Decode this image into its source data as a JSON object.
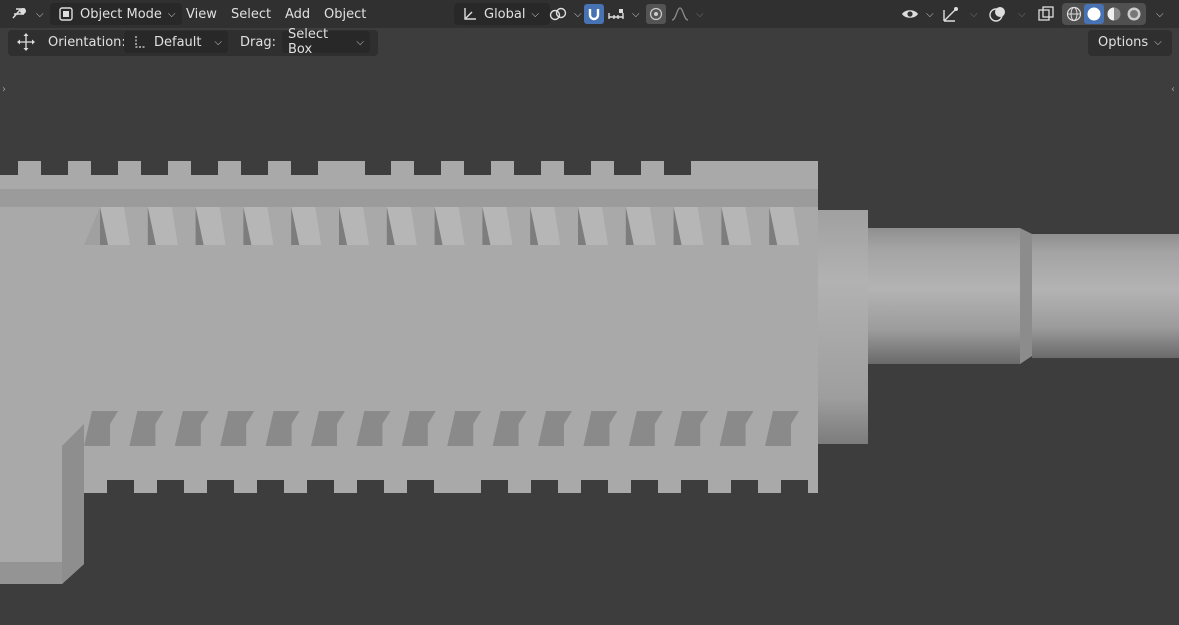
{
  "header": {
    "editor_type_icon": "viewport-editor-icon",
    "mode": {
      "icon": "object-mode-icon",
      "label": "Object Mode"
    },
    "menus": [
      "View",
      "Select",
      "Add",
      "Object"
    ],
    "transform_orientation": {
      "icon": "global-orientation-icon",
      "label": "Global"
    },
    "pivot_icon": "pivot-link-icon",
    "snap_icon": "magnet-snap-icon",
    "snap_target_icon": "snap-increment-icon",
    "proportional_icon": "proportional-editing-icon",
    "falloff_icon": "falloff-curve-icon",
    "right_icons": [
      "visibility-eye-icon",
      "gizmo-icon",
      "overlays-icon",
      "xray-icon",
      "wireframe-shading-icon",
      "solid-shading-icon",
      "material-shading-icon",
      "rendered-shading-icon"
    ]
  },
  "tool_settings": {
    "transform_icon": "move-tool-icon",
    "orientation_label": "Orientation:",
    "orientation_value": "Default",
    "drag_label": "Drag:",
    "drag_value": "Select Box",
    "options_label": "Options"
  },
  "colors": {
    "header_bg": "#303030",
    "viewport_bg": "#3d3d3d",
    "accent": "#4772b3",
    "model_light": "#a9a9aa",
    "model_shadow": "#8a8a8b"
  }
}
